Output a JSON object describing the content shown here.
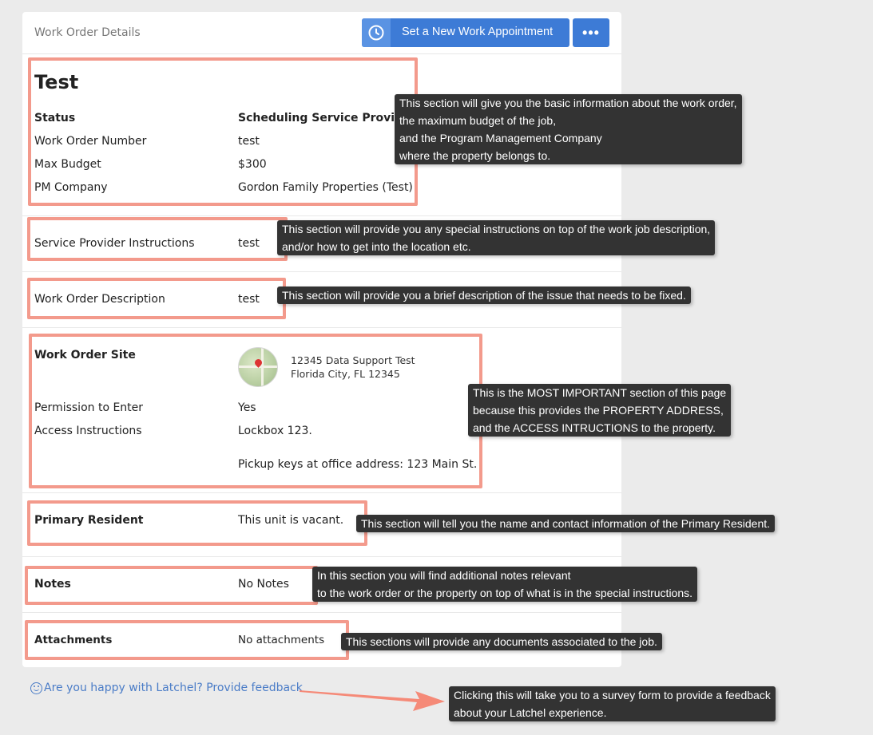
{
  "header": {
    "title": "Work Order Details",
    "appointment_button": "Set a New Work Appointment",
    "more_button": "•••"
  },
  "work_order": {
    "name": "Test",
    "status_label": "Status",
    "status_value": "Scheduling Service Provider",
    "number_label": "Work Order Number",
    "number_value": "test",
    "budget_label": "Max Budget",
    "budget_value": "$300",
    "pm_label": "PM Company",
    "pm_value": "Gordon Family Properties (Test)"
  },
  "instructions": {
    "label": "Service Provider Instructions",
    "value": "test"
  },
  "description": {
    "label": "Work Order Description",
    "value": "test"
  },
  "site": {
    "label": "Work Order Site",
    "address_line1": "12345 Data Support Test",
    "address_line2": "Florida City, FL 12345",
    "permission_label": "Permission to Enter",
    "permission_value": "Yes",
    "access_label": "Access Instructions",
    "access_line1": "Lockbox 123.",
    "access_line2": "Pickup keys at office address: 123 Main St."
  },
  "resident": {
    "label": "Primary Resident",
    "value": "This unit is vacant."
  },
  "notes": {
    "label": "Notes",
    "value": "No Notes"
  },
  "attachments": {
    "label": "Attachments",
    "value": "No attachments"
  },
  "feedback_link": "Are you happy with Latchel? Provide feedback",
  "tooltips": {
    "basic": [
      "This section will give you the basic information about the work order,",
      "the maximum budget of the job,",
      "and the Program Management Company",
      "where the property belongs to."
    ],
    "instructions": [
      "This section will provide you any special instructions on top of the work job description,",
      "and/or how to get into the location etc."
    ],
    "description": [
      "This section will provide you a brief description of the issue that needs to be fixed."
    ],
    "site": [
      "This is the MOST IMPORTANT section of this page",
      "because this provides the PROPERTY ADDRESS,",
      "and the ACCESS INTRUCTIONS to the property."
    ],
    "resident": [
      "This section will tell you the name and contact information of the Primary Resident."
    ],
    "notes": [
      "In this section you will find additional notes relevant",
      "to the work order or the property on top of what is in the special instructions."
    ],
    "attachments": [
      "This sections will provide any documents associated to the job."
    ],
    "feedback": [
      "Clicking this will take  you to a survey form to provide a feedback",
      "about your Latchel experience."
    ]
  },
  "colors": {
    "primary_button": "#3d7bd6",
    "highlight": "#f39a8c",
    "tooltip_bg": "#333333",
    "link": "#4a7cc7"
  }
}
